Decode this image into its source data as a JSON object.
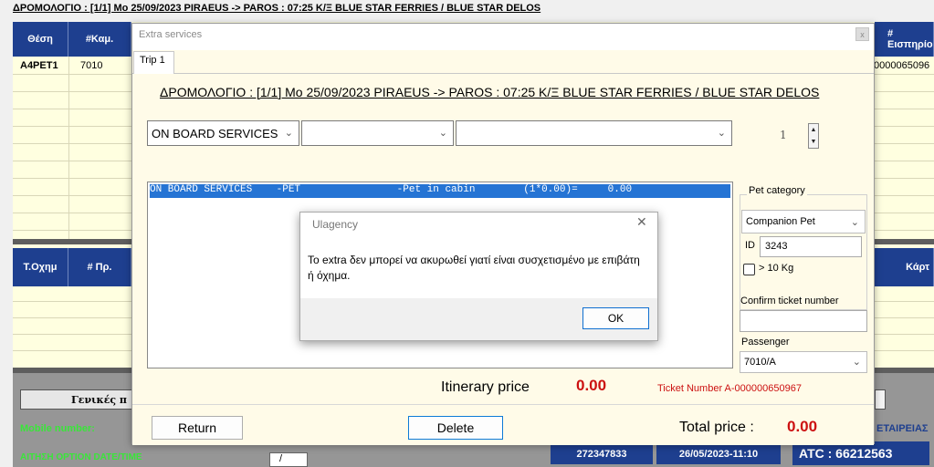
{
  "background": {
    "route_header": "ΔΡΟΜΟΛΟΓΙΟ : [1/1]  Mo 25/09/2023   PIRAEUS -> PAROS : 07:25   K/Ξ BLUE STAR FERRIES  /  BLUE STAR DELOS",
    "seat_col": "Θέση",
    "cabin_col": "#Καμ.",
    "receipt_col": "# Εισπηρίο",
    "seat_value": "A4PET1",
    "cabin_value": "7010",
    "receipt_value": "0000065096",
    "vehicle_col": "Τ.Οχημ",
    "pr_col": "# Πρ.",
    "card_col": "Κάρτ",
    "general_label": "Γενικές π",
    "mobile_label": "Mobile number:",
    "option_label": "ΑΙΤΗΣΗ OPTION DATE/TIME",
    "company_label": "ΕΤΑΙΡΕΙΑΣ",
    "slash_value": "/",
    "code_value": "272347833",
    "date_value": "26/05/2023-11:10",
    "atc_value": "ATC : 66212563"
  },
  "dialog": {
    "title": "Extra services",
    "close": "x",
    "tab": "Trip 1",
    "route_line": "ΔΡΟΜΟΛΟΓΙΟ : [1/1]  Mo 25/09/2023   PIRAEUS -> PAROS : 07:25   K/Ξ BLUE STAR FERRIES  /  BLUE STAR DELOS",
    "service_combo": "ON BOARD SERVICES",
    "quantity": "1",
    "list_row": "ON BOARD SERVICES    -PET                -Pet in cabin        (1*0.00)=     0.00",
    "pet_category_label": "Pet category",
    "pet_category_value": "Companion Pet",
    "id_label": "ID",
    "id_value": "3243",
    "over_10kg_label": "> 10 Kg",
    "confirm_ticket_label": "Confirm ticket number",
    "confirm_ticket_value": "",
    "passenger_label": "Passenger",
    "passenger_value": "7010/A",
    "itinerary_label": "Itinerary price",
    "itinerary_price": "0.00",
    "ticket_number": "Ticket Number A-000000650967",
    "return_button": "Return",
    "delete_button": "Delete",
    "total_label": "Total price :",
    "total_price": "0.00"
  },
  "msgbox": {
    "title": "Ulagency",
    "close": "✕",
    "message": "Το extra δεν μπορεί να ακυρωθεί γιατί είναι συσχετισμένο με επιβάτη ή όχημα.",
    "ok_button": "OK"
  },
  "colors": {
    "header_blue": "#1e3f8f",
    "grid_yellow": "#ffffe0",
    "selection_blue": "#2574d4",
    "price_red": "#cc1111",
    "mobile_green": "#39e639"
  }
}
